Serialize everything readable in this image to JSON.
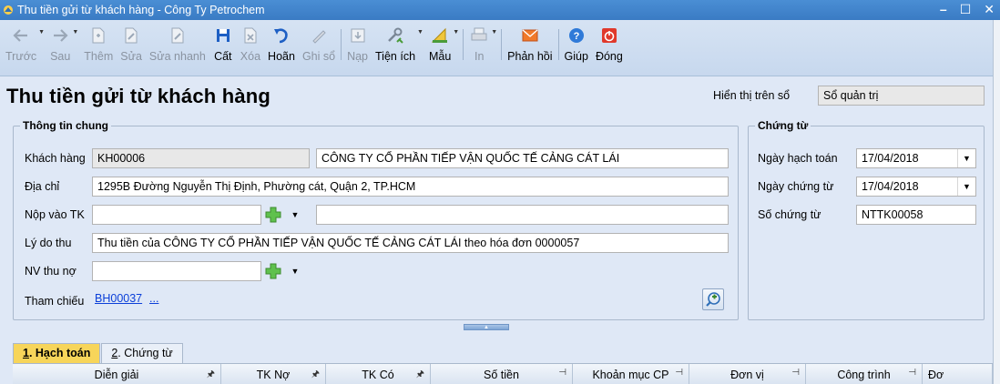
{
  "window": {
    "title": "Thu tiền gửi từ khách hàng - Công Ty Petrochem"
  },
  "toolbar": {
    "items": [
      {
        "label": "Trước",
        "icon": "arrow-left-icon",
        "enabled": false
      },
      {
        "label": "Sau",
        "icon": "arrow-right-icon",
        "enabled": false
      },
      {
        "label": "Thêm",
        "icon": "add-document-icon",
        "enabled": false
      },
      {
        "label": "Sửa",
        "icon": "edit-document-icon",
        "enabled": false
      },
      {
        "label": "Sửa nhanh",
        "icon": "quick-edit-icon",
        "enabled": false
      },
      {
        "label": "Cất",
        "icon": "save-icon",
        "enabled": true
      },
      {
        "label": "Xóa",
        "icon": "delete-icon",
        "enabled": false
      },
      {
        "label": "Hoãn",
        "icon": "undo-icon",
        "enabled": true
      },
      {
        "label": "Ghi sổ",
        "icon": "post-ledger-icon",
        "enabled": false
      },
      {
        "label": "Nạp",
        "icon": "load-icon",
        "enabled": false
      },
      {
        "label": "Tiện ích",
        "icon": "utilities-icon",
        "enabled": true
      },
      {
        "label": "Mẫu",
        "icon": "template-icon",
        "enabled": true
      },
      {
        "label": "In",
        "icon": "print-icon",
        "enabled": false
      },
      {
        "label": "Phản hồi",
        "icon": "feedback-mail-icon",
        "enabled": true
      },
      {
        "label": "Giúp",
        "icon": "help-icon",
        "enabled": true
      },
      {
        "label": "Đóng",
        "icon": "power-close-icon",
        "enabled": true
      }
    ]
  },
  "header": {
    "title": "Thu tiền gửi từ khách hàng",
    "display_label": "Hiển thị trên sổ",
    "display_value": "Sổ quản trị"
  },
  "general": {
    "title": "Thông tin chung",
    "customer_label": "Khách hàng",
    "customer_code": "KH00006",
    "customer_name": "CÔNG TY CỔ PHẦN TIẾP VẬN QUỐC TẾ CẢNG CÁT LÁI",
    "address_label": "Địa chỉ",
    "address": "1295B Đường Nguyễn Thị Định, Phường cát, Quận 2, TP.HCM",
    "account_label": "Nộp vào TK",
    "account_value": "",
    "account_name": "",
    "reason_label": "Lý do thu",
    "reason": "Thu tiền của CÔNG TY CỔ PHẦN TIẾP VẬN QUỐC TẾ CẢNG CÁT LÁI theo hóa đơn 0000057",
    "staff_label": "NV thu nợ",
    "staff_value": "",
    "reference_label": "Tham chiếu",
    "reference_link": "BH00037",
    "reference_more": "..."
  },
  "voucher": {
    "title": "Chứng từ",
    "posting_date_label": "Ngày hạch toán",
    "posting_date": "17/04/2018",
    "voucher_date_label": "Ngày chứng từ",
    "voucher_date": "17/04/2018",
    "voucher_no_label": "Số chứng từ",
    "voucher_no": "NTTK00058"
  },
  "tabs": [
    {
      "num": "1",
      "label": ". Hạch toán",
      "active": true
    },
    {
      "num": "2",
      "label": ". Chứng từ",
      "active": false
    }
  ],
  "grid": {
    "columns": [
      "Diễn giải",
      "TK Nợ",
      "TK Có",
      "Số tiền",
      "Khoản mục CP",
      "Đơn vị",
      "Công trình",
      "Đơ"
    ]
  }
}
